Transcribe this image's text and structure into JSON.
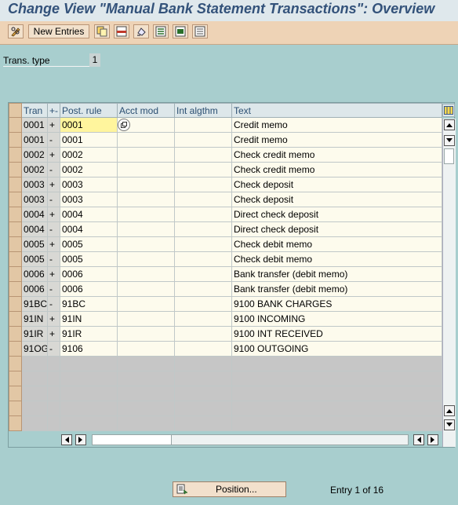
{
  "window": {
    "title": "Change View \"Manual Bank Statement Transactions\": Overview"
  },
  "toolbar": {
    "new_entries_label": "New Entries",
    "icons": [
      "edit-glasses-icon",
      "copy-icon",
      "delete-icon",
      "undo-icon",
      "select-all-icon",
      "select-block-icon",
      "deselect-all-icon"
    ]
  },
  "header_field": {
    "label": "Trans. type",
    "value": "1"
  },
  "table": {
    "columns": [
      "Tran",
      "+-",
      "Post. rule",
      "Acct mod",
      "Int algthm",
      "Text"
    ],
    "rows": [
      {
        "tran": "0001",
        "sign": "+",
        "post_rule": "0001",
        "acct_mod": "",
        "int_algthm": "",
        "text": "Credit memo"
      },
      {
        "tran": "0001",
        "sign": "-",
        "post_rule": "0001",
        "acct_mod": "",
        "int_algthm": "",
        "text": "Credit memo"
      },
      {
        "tran": "0002",
        "sign": "+",
        "post_rule": "0002",
        "acct_mod": "",
        "int_algthm": "",
        "text": "Check credit memo"
      },
      {
        "tran": "0002",
        "sign": "-",
        "post_rule": "0002",
        "acct_mod": "",
        "int_algthm": "",
        "text": "Check credit memo"
      },
      {
        "tran": "0003",
        "sign": "+",
        "post_rule": "0003",
        "acct_mod": "",
        "int_algthm": "",
        "text": "Check deposit"
      },
      {
        "tran": "0003",
        "sign": "-",
        "post_rule": "0003",
        "acct_mod": "",
        "int_algthm": "",
        "text": "Check deposit"
      },
      {
        "tran": "0004",
        "sign": "+",
        "post_rule": "0004",
        "acct_mod": "",
        "int_algthm": "",
        "text": "Direct check deposit"
      },
      {
        "tran": "0004",
        "sign": "-",
        "post_rule": "0004",
        "acct_mod": "",
        "int_algthm": "",
        "text": "Direct check deposit"
      },
      {
        "tran": "0005",
        "sign": "+",
        "post_rule": "0005",
        "acct_mod": "",
        "int_algthm": "",
        "text": "Check debit memo"
      },
      {
        "tran": "0005",
        "sign": "-",
        "post_rule": "0005",
        "acct_mod": "",
        "int_algthm": "",
        "text": "Check debit memo"
      },
      {
        "tran": "0006",
        "sign": "+",
        "post_rule": "0006",
        "acct_mod": "",
        "int_algthm": "",
        "text": "Bank transfer (debit memo)"
      },
      {
        "tran": "0006",
        "sign": "-",
        "post_rule": "0006",
        "acct_mod": "",
        "int_algthm": "",
        "text": "Bank transfer (debit memo)"
      },
      {
        "tran": "91BC",
        "sign": "-",
        "post_rule": "91BC",
        "acct_mod": "",
        "int_algthm": "",
        "text": "9100 BANK CHARGES"
      },
      {
        "tran": "91IN",
        "sign": "+",
        "post_rule": "91IN",
        "acct_mod": "",
        "int_algthm": "",
        "text": "9100 INCOMING"
      },
      {
        "tran": "91IR",
        "sign": "+",
        "post_rule": "91IR",
        "acct_mod": "",
        "int_algthm": "",
        "text": "9100 INT RECEIVED"
      },
      {
        "tran": "91OG",
        "sign": "-",
        "post_rule": "9106",
        "acct_mod": "",
        "int_algthm": "",
        "text": "9100 OUTGOING"
      }
    ],
    "empty_rows": 5,
    "active_cell": "post_rule-0"
  },
  "footer": {
    "position_button_label": "Position...",
    "entry_info": "Entry 1 of 16"
  },
  "colors": {
    "background": "#a8cece",
    "title_text": "#33527a",
    "toolbar": "#eed3b6",
    "cell_input": "#fdfbed",
    "active_cell": "#fff59d"
  }
}
